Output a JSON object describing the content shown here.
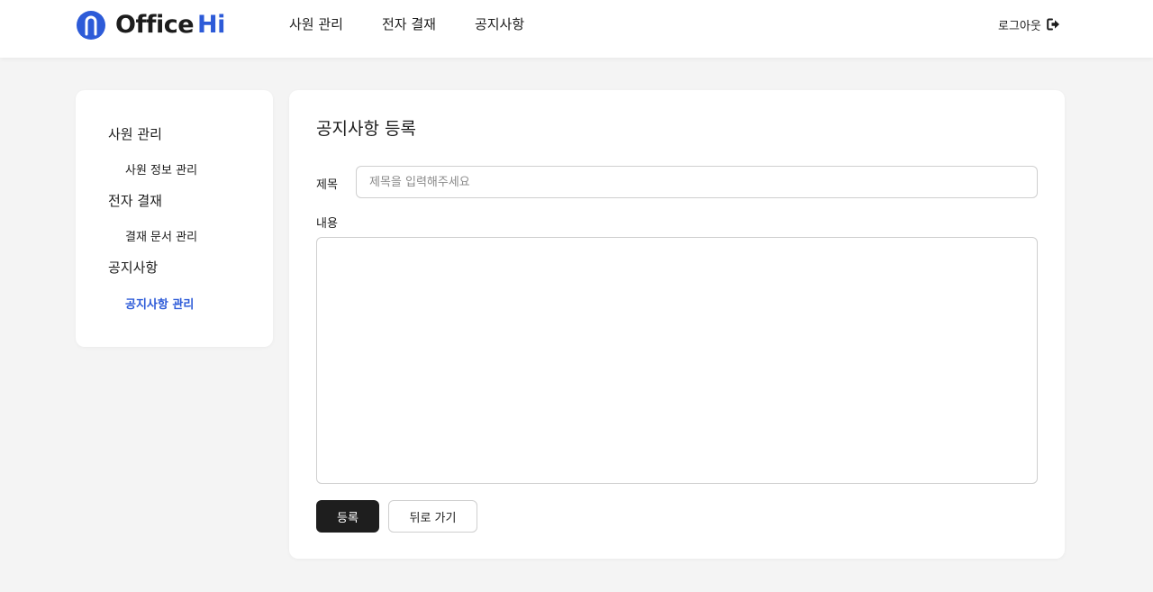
{
  "app": {
    "logo_office": "Office",
    "logo_hi": "Hi",
    "logout_label": "로그아웃",
    "colors": {
      "accent": "#2d5bd8",
      "primary_button": "#1e1e1e",
      "background": "#f4f4f4"
    }
  },
  "topnav": {
    "items": [
      {
        "label": "사원 관리"
      },
      {
        "label": "전자 결재"
      },
      {
        "label": "공지사항"
      }
    ]
  },
  "sidebar": {
    "groups": [
      {
        "label": "사원 관리",
        "items": [
          {
            "label": "사원 정보 관리",
            "active": false
          }
        ]
      },
      {
        "label": "전자 결재",
        "items": [
          {
            "label": "결재 문서 관리",
            "active": false
          }
        ]
      },
      {
        "label": "공지사항",
        "items": [
          {
            "label": "공지사항 관리",
            "active": true
          }
        ]
      }
    ]
  },
  "form": {
    "heading": "공지사항 등록",
    "title_label": "제목",
    "title_placeholder": "제목을 입력해주세요",
    "title_value": "",
    "content_label": "내용",
    "content_value": "",
    "submit_label": "등록",
    "back_label": "뒤로 가기"
  },
  "icons": {
    "logo": "paperclip-logo-icon",
    "logout": "sign-out-icon"
  }
}
